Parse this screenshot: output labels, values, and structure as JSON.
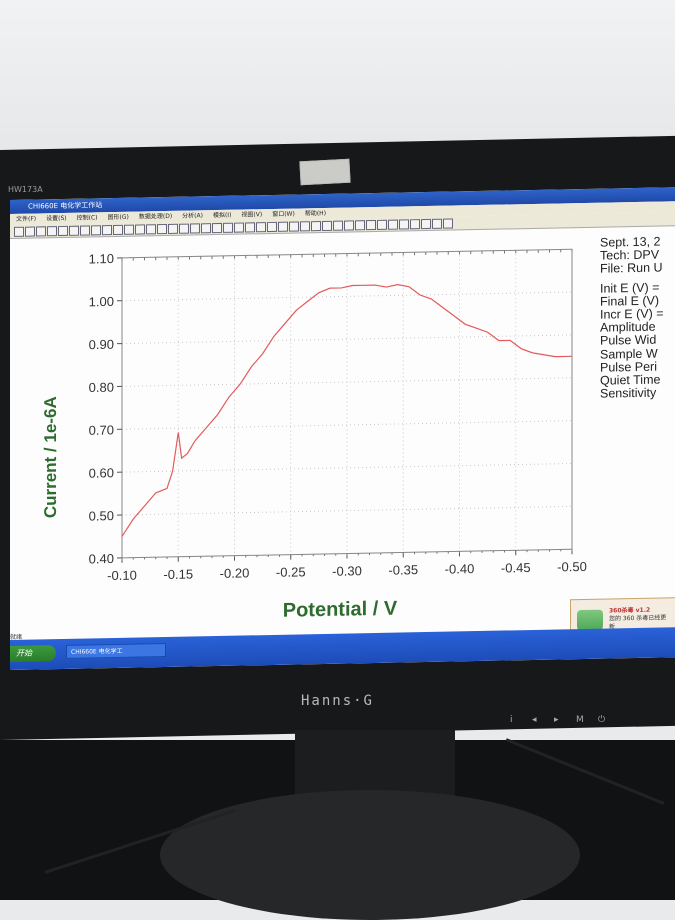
{
  "monitor": {
    "model_label": "HW173A",
    "brand": "Hanns·G",
    "buttons": [
      "i",
      "◂",
      "▸",
      "M",
      "⏻"
    ]
  },
  "window": {
    "title": "CHI660E 电化学工作站",
    "menu": [
      "文件(F)",
      "设置(S)",
      "控制(C)",
      "图形(G)",
      "数据处理(D)",
      "分析(A)",
      "模拟(I)",
      "视图(V)",
      "窗口(W)",
      "帮助(H)"
    ]
  },
  "chart_data": {
    "type": "line",
    "xlabel": "Potential / V",
    "ylabel": "Current / 1e-6A",
    "xlim": [
      -0.1,
      -0.5
    ],
    "ylim": [
      0.4,
      1.1
    ],
    "x_ticks": [
      "-0.10",
      "-0.15",
      "-0.20",
      "-0.25",
      "-0.30",
      "-0.35",
      "-0.40",
      "-0.45",
      "-0.50"
    ],
    "y_ticks": [
      "1.10",
      "1.00",
      "0.90",
      "0.80",
      "0.70",
      "0.60",
      "0.50",
      "0.40"
    ],
    "line_color": "#e45a5a",
    "grid": "dotted",
    "series": [
      {
        "x": [
          -0.1,
          -0.11,
          -0.12,
          -0.13,
          -0.14,
          -0.145,
          -0.15,
          -0.153,
          -0.158,
          -0.165,
          -0.175,
          -0.185,
          -0.195,
          -0.205,
          -0.215,
          -0.225,
          -0.235,
          -0.245,
          -0.255,
          -0.265,
          -0.275,
          -0.285,
          -0.295,
          -0.305,
          -0.315,
          -0.325,
          -0.335,
          -0.345,
          -0.355,
          -0.365,
          -0.375,
          -0.385,
          -0.395,
          -0.405,
          -0.415,
          -0.425,
          -0.435,
          -0.445,
          -0.455,
          -0.465,
          -0.475,
          -0.485,
          -0.495,
          -0.5
        ],
        "y": [
          0.45,
          0.49,
          0.52,
          0.55,
          0.56,
          0.6,
          0.69,
          0.63,
          0.64,
          0.67,
          0.7,
          0.73,
          0.77,
          0.8,
          0.84,
          0.87,
          0.91,
          0.94,
          0.97,
          0.99,
          1.01,
          1.02,
          1.02,
          1.025,
          1.025,
          1.025,
          1.02,
          1.025,
          1.02,
          1.0,
          0.99,
          0.97,
          0.95,
          0.93,
          0.92,
          0.91,
          0.89,
          0.89,
          0.87,
          0.86,
          0.855,
          0.85,
          0.85,
          0.85
        ]
      }
    ]
  },
  "info_panel": {
    "date": "Sept. 13, 2",
    "tech": "Tech: DPV",
    "file": "File: Run U",
    "init_e": "Init E (V) =",
    "final_e": "Final E (V)",
    "incr_e": "Incr E (V) =",
    "amplitude": "Amplitude",
    "pulse_width": "Pulse Wid",
    "sample_width": "Sample W",
    "pulse_period": "Pulse Peri",
    "quiet_time": "Quiet Time",
    "sensitivity": "Sensitivity"
  },
  "taskbar": {
    "start_label": "开始",
    "task_label": "CHI660E 电化学工",
    "status_text": "就绪"
  },
  "popup": {
    "title": "360杀毒 v1.2",
    "text": "您的 360 杀毒已经更新"
  }
}
